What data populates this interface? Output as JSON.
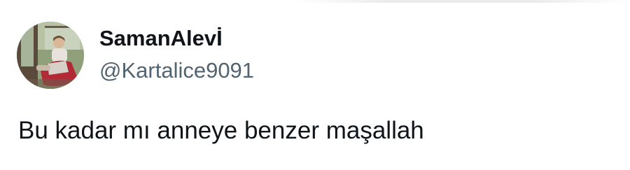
{
  "tweet": {
    "author": {
      "display_name": "SamanAlevİ",
      "handle": "@Kartalice9091",
      "avatar_icon": "profile-photo"
    },
    "text": "Bu kadar mı anneye benzer maşallah"
  },
  "colors": {
    "name": "#0f1419",
    "handle": "#536471",
    "text": "#0f1419",
    "background": "#ffffff"
  }
}
